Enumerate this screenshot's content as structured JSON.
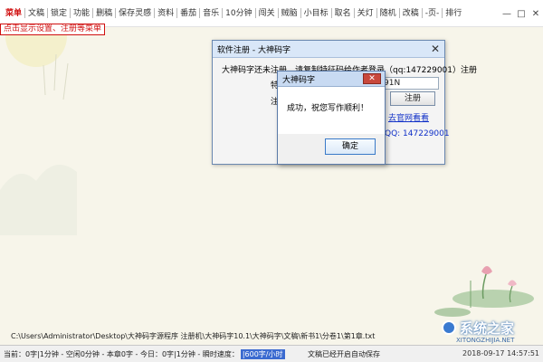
{
  "menubar": {
    "items": [
      "菜单",
      "文稿",
      "锁定",
      "功能",
      "删稿",
      "保存灵感",
      "资料",
      "番茄",
      "音乐",
      "10分钟",
      "闯关",
      "贼脑",
      "小目标",
      "取名",
      "关灯",
      "随机",
      "改稿",
      "-页-",
      "排行"
    ]
  },
  "window_controls": {
    "minimize": "—",
    "maximize": "□",
    "close": "✕"
  },
  "redbar": {
    "text": "点击显示设置、注册等菜单"
  },
  "reg_dialog": {
    "title": "软件注册 - 大神码字",
    "notice": "大神码字还未注册，请复制特征码给作者登录（qq:147229001）注册",
    "label1": "特",
    "machine_code_value": "91N",
    "label2": "注",
    "register_button": "注册",
    "link": "去官网看看",
    "qq": "QQ: 147229001"
  },
  "message_box": {
    "title": "大神码字",
    "text": "成功，祝您写作顺利！",
    "ok_button": "确定"
  },
  "path": "C:\\Users\\Administrator\\Desktop\\大神码字源程序 注册机\\大神码字10.1\\大神码字\\文稿\\新书1\\分卷1\\第1章.txt",
  "statusbar": {
    "seg1": "当前：0字|1分钟 - 空闲0分钟 - 本章0字 - 今日：0字|1分钟 - 瞬时速度：",
    "speed": "|600字/小时",
    "autosave": "文稿已经开启自动保存",
    "clock": "2018-09-17 14:57:51"
  },
  "watermark": {
    "text": "系统之家",
    "url": "XITONGZHIJIA.NET"
  }
}
